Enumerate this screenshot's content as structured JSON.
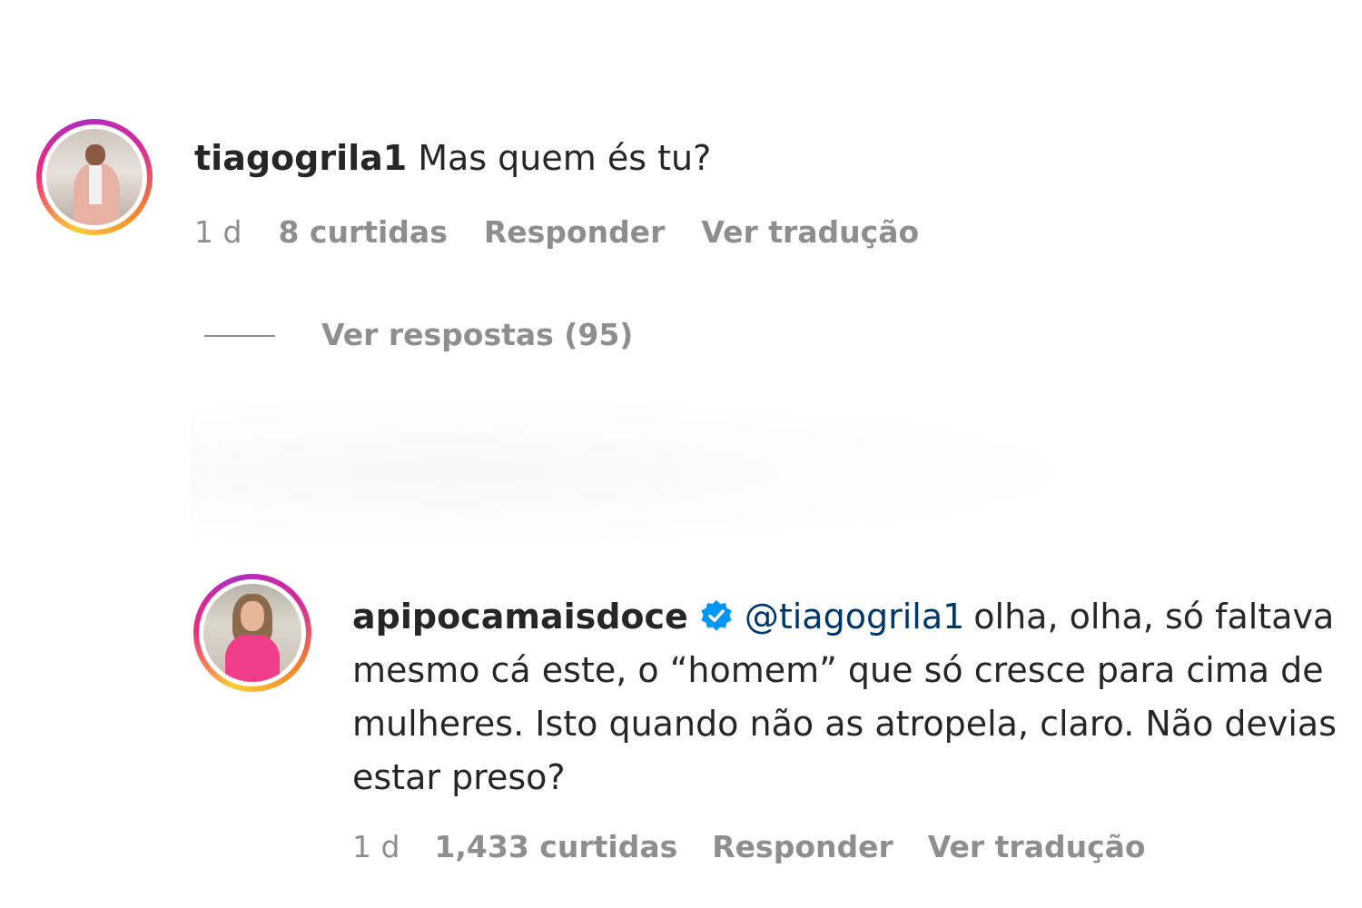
{
  "comment1": {
    "username": "tiagogrila1",
    "text": "Mas quem és tu?",
    "time": "1 d",
    "likes": "8 curtidas",
    "reply_label": "Responder",
    "translate_label": "Ver tradução"
  },
  "view_replies": {
    "label": "Ver respostas (95)"
  },
  "comment2": {
    "username": "apipocamaisdoce",
    "verified": true,
    "mention": "@tiagogrila1",
    "text": "olha, olha, só faltava mesmo cá este, o “homem” que só cresce para cima de mulheres. Isto quando não as atropela, claro. Não devias estar preso?",
    "time": "1 d",
    "likes": "1,433 curtidas",
    "reply_label": "Responder",
    "translate_label": "Ver tradução"
  },
  "colors": {
    "text": "#262626",
    "muted": "#8e8e8e",
    "mention": "#00376b",
    "verified": "#0095f6"
  }
}
